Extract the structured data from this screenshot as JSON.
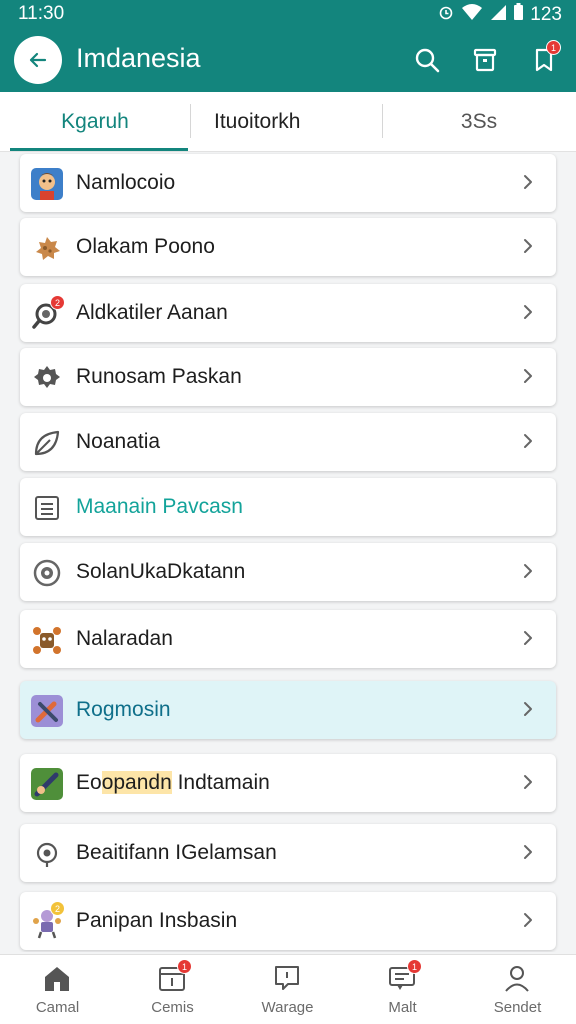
{
  "status": {
    "time": "11:30",
    "battery": "123"
  },
  "appbar": {
    "title": "Imdanesia",
    "notification_count": "1"
  },
  "tabs": [
    {
      "label": "Kgaruh"
    },
    {
      "label": "Ituoitorkh"
    },
    {
      "label": "3Ss"
    }
  ],
  "list": {
    "items": [
      {
        "label": "Namlocoio",
        "icon": "character-avatar-icon"
      },
      {
        "label": "Olakam Poono",
        "icon": "cookie-icon"
      },
      {
        "label": "Aldkatiler Aanan",
        "icon": "magnifier-alert-icon",
        "badge": "2"
      },
      {
        "label": "Runosam Paskan",
        "icon": "gear-icon"
      },
      {
        "label": "Noanatia",
        "icon": "leaf-icon"
      },
      {
        "label": "Maanain Pavcasn",
        "icon": "document-icon"
      },
      {
        "label": "SolanUkaDkatann",
        "icon": "target-icon"
      },
      {
        "label": "Nalaradan",
        "icon": "robot-icon"
      },
      {
        "label": "Rogmosin",
        "icon": "wrench-tool-icon"
      },
      {
        "label_prefix": "Eo",
        "label_highlight": "opandn",
        "label_suffix": " Indtamain",
        "icon": "game-art-icon"
      },
      {
        "label": "Beaitifann IGelamsan",
        "icon": "location-icon"
      },
      {
        "label": "Panipan Insbasin",
        "icon": "puppet-icon",
        "badge": "2"
      }
    ]
  },
  "bottomnav": [
    {
      "label": "Camal",
      "icon": "home-icon"
    },
    {
      "label": "Cemis",
      "icon": "calendar-icon",
      "badge": "1"
    },
    {
      "label": "Warage",
      "icon": "chat-icon"
    },
    {
      "label": "Malt",
      "icon": "message-icon",
      "badge": "1"
    },
    {
      "label": "Sendet",
      "icon": "profile-icon"
    }
  ],
  "colors": {
    "primary": "#13857d",
    "accent": "#13a39a",
    "badge": "#e53935",
    "selected_bg": "#dff4f7"
  }
}
